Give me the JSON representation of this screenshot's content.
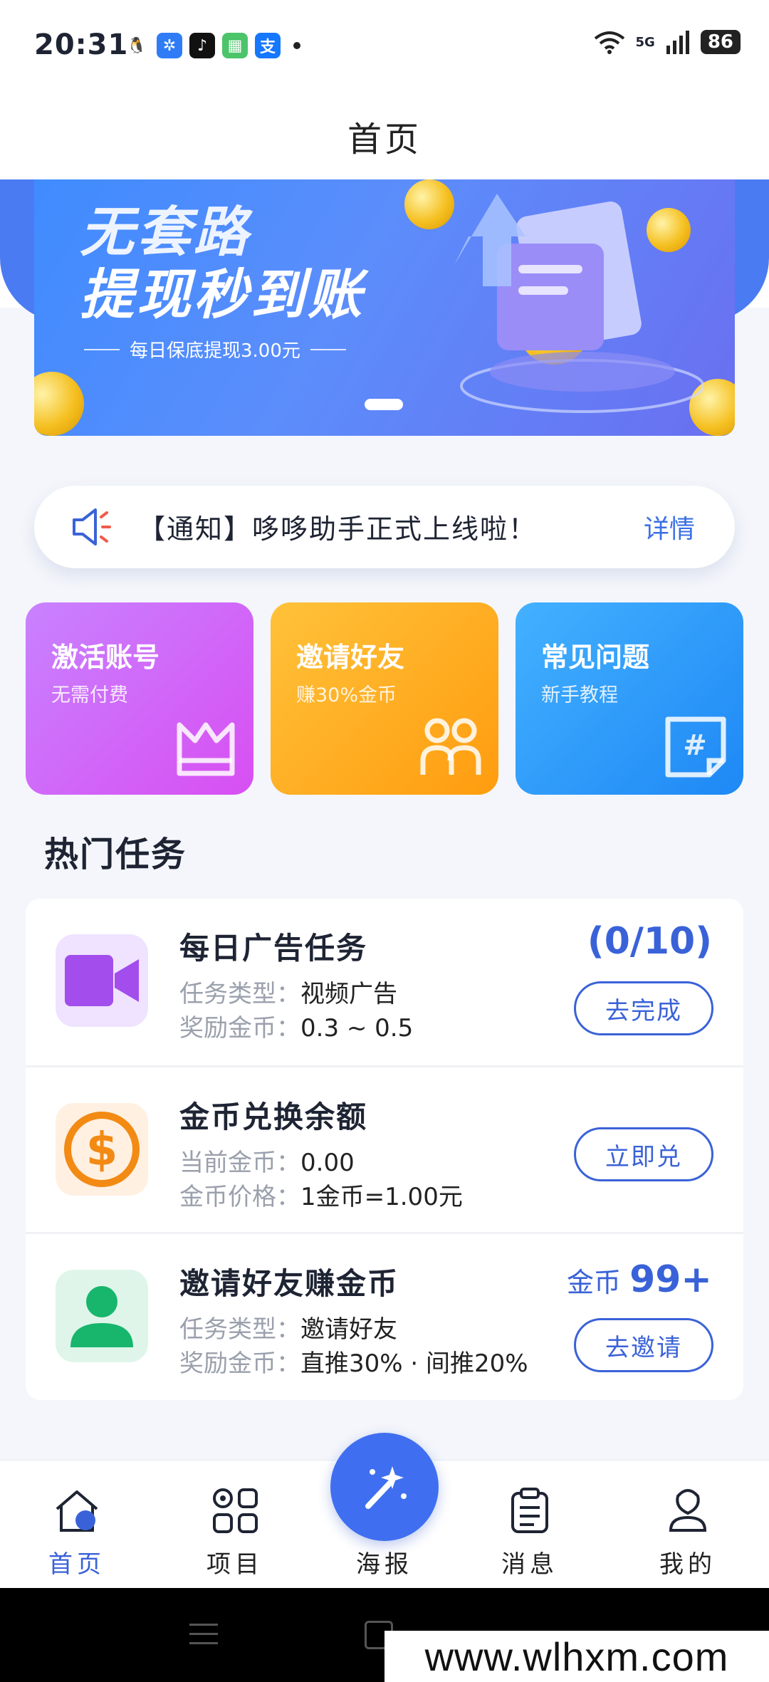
{
  "status_bar": {
    "time": "20:31",
    "apps": [
      {
        "name": "qq-icon",
        "glyph": "🐧",
        "color": "#ffffff"
      },
      {
        "name": "pinwheel-app-icon",
        "glyph": "✲",
        "color": "#2f7cf6"
      },
      {
        "name": "tiktok-icon",
        "glyph": "♪",
        "color": "#111111"
      },
      {
        "name": "game-app-icon",
        "glyph": "▦",
        "color": "#4cc46a"
      },
      {
        "name": "alipay-icon",
        "glyph": "支",
        "color": "#e8453c"
      }
    ],
    "network": "5G",
    "battery": "86"
  },
  "header": {
    "title": "首页"
  },
  "banner": {
    "line1": "无套路",
    "line2": "提现秒到账",
    "subtitle": "每日保底提现3.00元"
  },
  "notice": {
    "text": "【通知】哆哆助手正式上线啦！",
    "detail_label": "详情"
  },
  "quick_actions": [
    {
      "title": "激活账号",
      "subtitle": "无需付费",
      "icon": "crown-icon"
    },
    {
      "title": "邀请好友",
      "subtitle": "赚30%金币",
      "icon": "friends-icon"
    },
    {
      "title": "常见问题",
      "subtitle": "新手教程",
      "icon": "hashtag-note-icon"
    }
  ],
  "section": {
    "title": "热门任务"
  },
  "tasks": [
    {
      "title": "每日广告任务",
      "line1_key": "任务类型：",
      "line1_val": "视频广告",
      "line2_key": "奖励金币：",
      "line2_val": "0.3 ~ 0.5",
      "progress": "(0/10)",
      "button": "去完成",
      "icon": "video-camera-icon"
    },
    {
      "title": "金币兑换余额",
      "line1_key": "当前金币：",
      "line1_val": "0.00",
      "line2_key": "金币价格：",
      "line2_val": "1金币=1.00元",
      "button": "立即兑",
      "icon": "dollar-coin-icon"
    },
    {
      "title": "邀请好友赚金币",
      "line1_key": "任务类型：",
      "line1_val": "邀请好友",
      "line2_key": "奖励金币：",
      "line2_val": "直推30% · 间推20%",
      "coin_label": "金币",
      "coin_value": "99+",
      "button": "去邀请",
      "icon": "user-icon"
    }
  ],
  "tab_bar": {
    "items": [
      {
        "label": "首页",
        "icon": "home-icon",
        "active": true
      },
      {
        "label": "项目",
        "icon": "grid-icon",
        "active": false
      },
      {
        "label": "海报",
        "icon": "magic-wand-icon",
        "active": false
      },
      {
        "label": "消息",
        "icon": "clipboard-icon",
        "active": false
      },
      {
        "label": "我的",
        "icon": "profile-icon",
        "active": false
      }
    ]
  },
  "watermark": "www.wlhxm.com",
  "colors": {
    "accent": "#3a62d8",
    "purple": "#d84ff2",
    "orange": "#ff9c0f",
    "blue": "#1e88f5"
  }
}
